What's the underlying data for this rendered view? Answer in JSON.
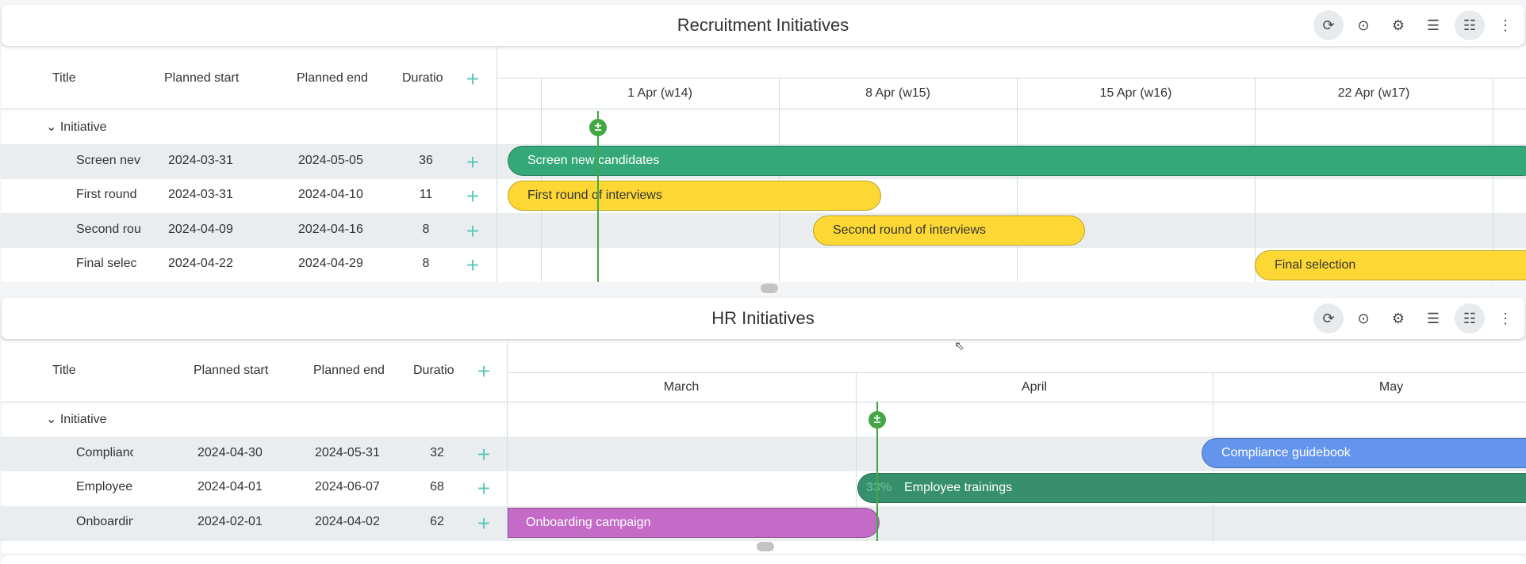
{
  "icons": [
    "refresh-icon",
    "target-icon",
    "gear-icon",
    "notes-icon",
    "workflow-icon",
    "more-vertical-icon"
  ],
  "colors": {
    "today": "#43a843",
    "green": "#35a87a",
    "yellow": "#fdd835",
    "blue": "#6495ed",
    "dark_green": "#37906d",
    "purple": "#c46bc8",
    "plus": "#5cc8b8"
  },
  "panel1": {
    "title": "Recruitment Initiatives",
    "columns": {
      "title": "Title",
      "start": "Planned start",
      "end": "Planned end",
      "duration": "Duratio"
    },
    "weeks": [
      "1 Apr (w14)",
      "8 Apr (w15)",
      "15 Apr (w16)",
      "22 Apr (w17)"
    ],
    "group": "Initiative",
    "rows": [
      {
        "title": "Screen nev",
        "start": "2024-03-31",
        "end": "2024-05-05",
        "duration": "36",
        "bar": "Screen new candidates"
      },
      {
        "title": "First round",
        "start": "2024-03-31",
        "end": "2024-04-10",
        "duration": "11",
        "bar": "First round of interviews"
      },
      {
        "title": "Second rou",
        "start": "2024-04-09",
        "end": "2024-04-16",
        "duration": "8",
        "bar": "Second round of interviews"
      },
      {
        "title": "Final selec",
        "start": "2024-04-22",
        "end": "2024-04-29",
        "duration": "8",
        "bar": "Final selection"
      }
    ]
  },
  "panel2": {
    "title": "HR Initiatives",
    "columns": {
      "title": "Title",
      "start": "Planned start",
      "end": "Planned end",
      "duration": "Duratio"
    },
    "months": [
      "March",
      "April",
      "May"
    ],
    "group": "Initiative",
    "rows": [
      {
        "title": "Compliance guic",
        "start": "2024-04-30",
        "end": "2024-05-31",
        "duration": "32",
        "bar": "Compliance guidebook"
      },
      {
        "title": "Employee trainir",
        "start": "2024-04-01",
        "end": "2024-06-07",
        "duration": "68",
        "bar": "Employee trainings",
        "progress": "33%"
      },
      {
        "title": "Onboarding can",
        "start": "2024-02-01",
        "end": "2024-04-02",
        "duration": "62",
        "bar": "Onboarding campaign"
      }
    ]
  }
}
